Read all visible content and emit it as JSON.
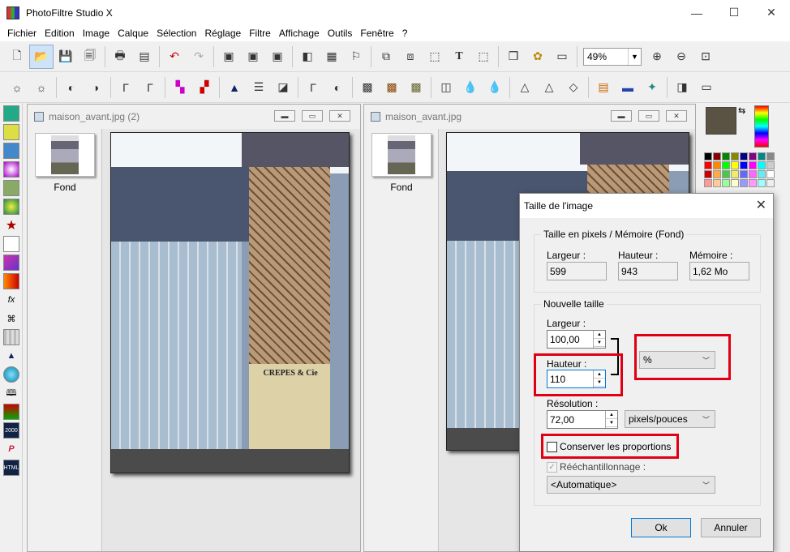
{
  "window": {
    "title": "PhotoFiltre Studio X",
    "minimize_glyph": "—",
    "maximize_glyph": "☐",
    "close_glyph": "✕"
  },
  "menu": [
    "Fichier",
    "Edition",
    "Image",
    "Calque",
    "Sélection",
    "Réglage",
    "Filtre",
    "Affichage",
    "Outils",
    "Fenêtre",
    "?"
  ],
  "toolbar": {
    "zoom_value": "49%",
    "zoom_arrow": "▼"
  },
  "docs": [
    {
      "title": "maison_avant.jpg (2)",
      "layer_name": "Fond"
    },
    {
      "title": "maison_avant.jpg",
      "layer_name": "Fond"
    }
  ],
  "photo_sign": "CREPES & Cie",
  "dialog": {
    "title": "Taille de l'image",
    "close_glyph": "✕",
    "pixel_group": {
      "label": "Taille en pixels / Mémoire (Fond)",
      "width_label": "Largeur :",
      "width_value": "599",
      "height_label": "Hauteur :",
      "height_value": "943",
      "memory_label": "Mémoire :",
      "memory_value": "1,62 Mo"
    },
    "new_group": {
      "label": "Nouvelle taille",
      "width_label": "Largeur :",
      "width_value": "100,00",
      "height_label": "Hauteur :",
      "height_value": "110",
      "unit_value": "%",
      "resolution_label": "Résolution :",
      "resolution_value": "72,00",
      "resolution_unit": "pixels/pouces",
      "keep_proportions_label": "Conserver les proportions",
      "keep_proportions_checked": false,
      "resample_label": "Rééchantillonnage :",
      "resample_checked": true,
      "resample_value": "<Automatique>"
    },
    "ok_label": "Ok",
    "cancel_label": "Annuler"
  }
}
